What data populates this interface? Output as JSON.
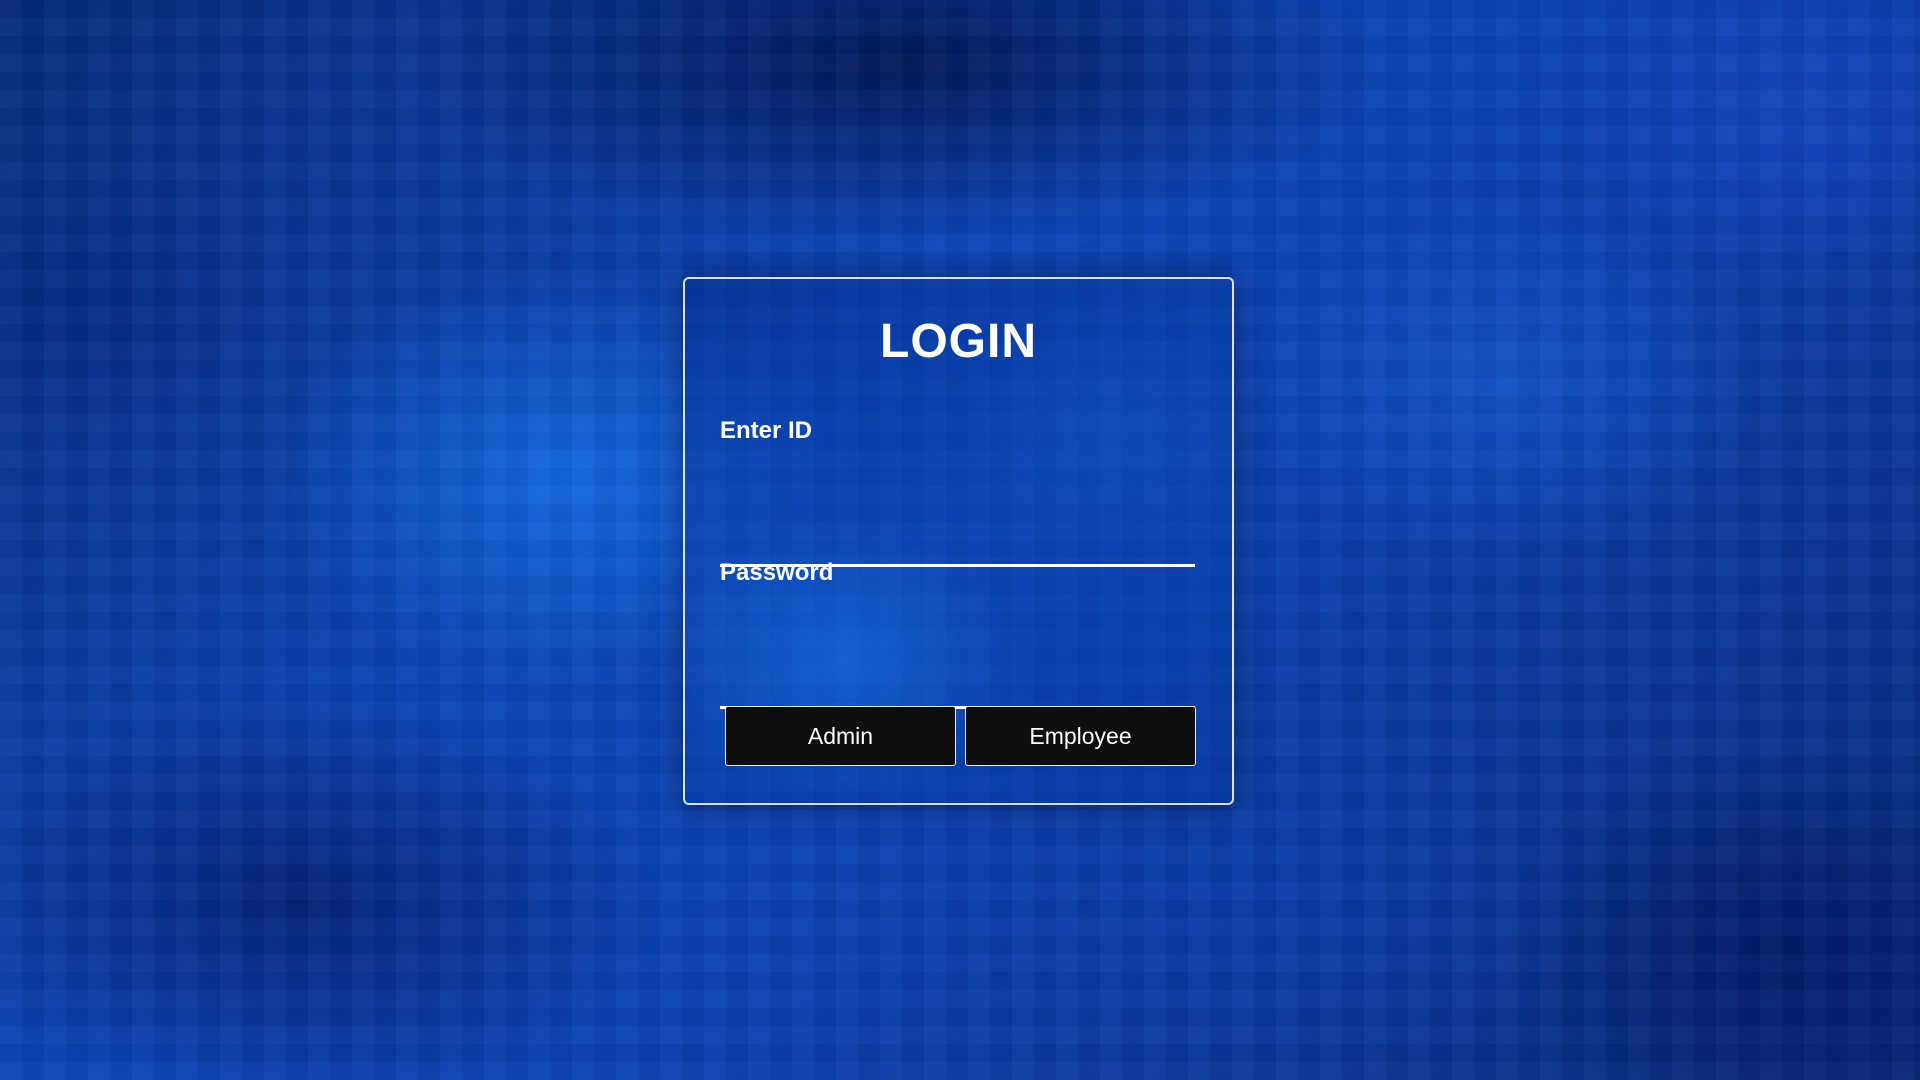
{
  "login": {
    "title": "LOGIN",
    "id_field": {
      "label": "Enter ID",
      "value": "",
      "placeholder": ""
    },
    "password_field": {
      "label": "Password",
      "value": "",
      "placeholder": ""
    },
    "buttons": {
      "admin": "Admin",
      "employee": "Employee"
    }
  },
  "colors": {
    "background": "#0a3fae",
    "card_border": "#ffffff",
    "button_background": "#0e0e0e",
    "text": "#ffffff"
  }
}
